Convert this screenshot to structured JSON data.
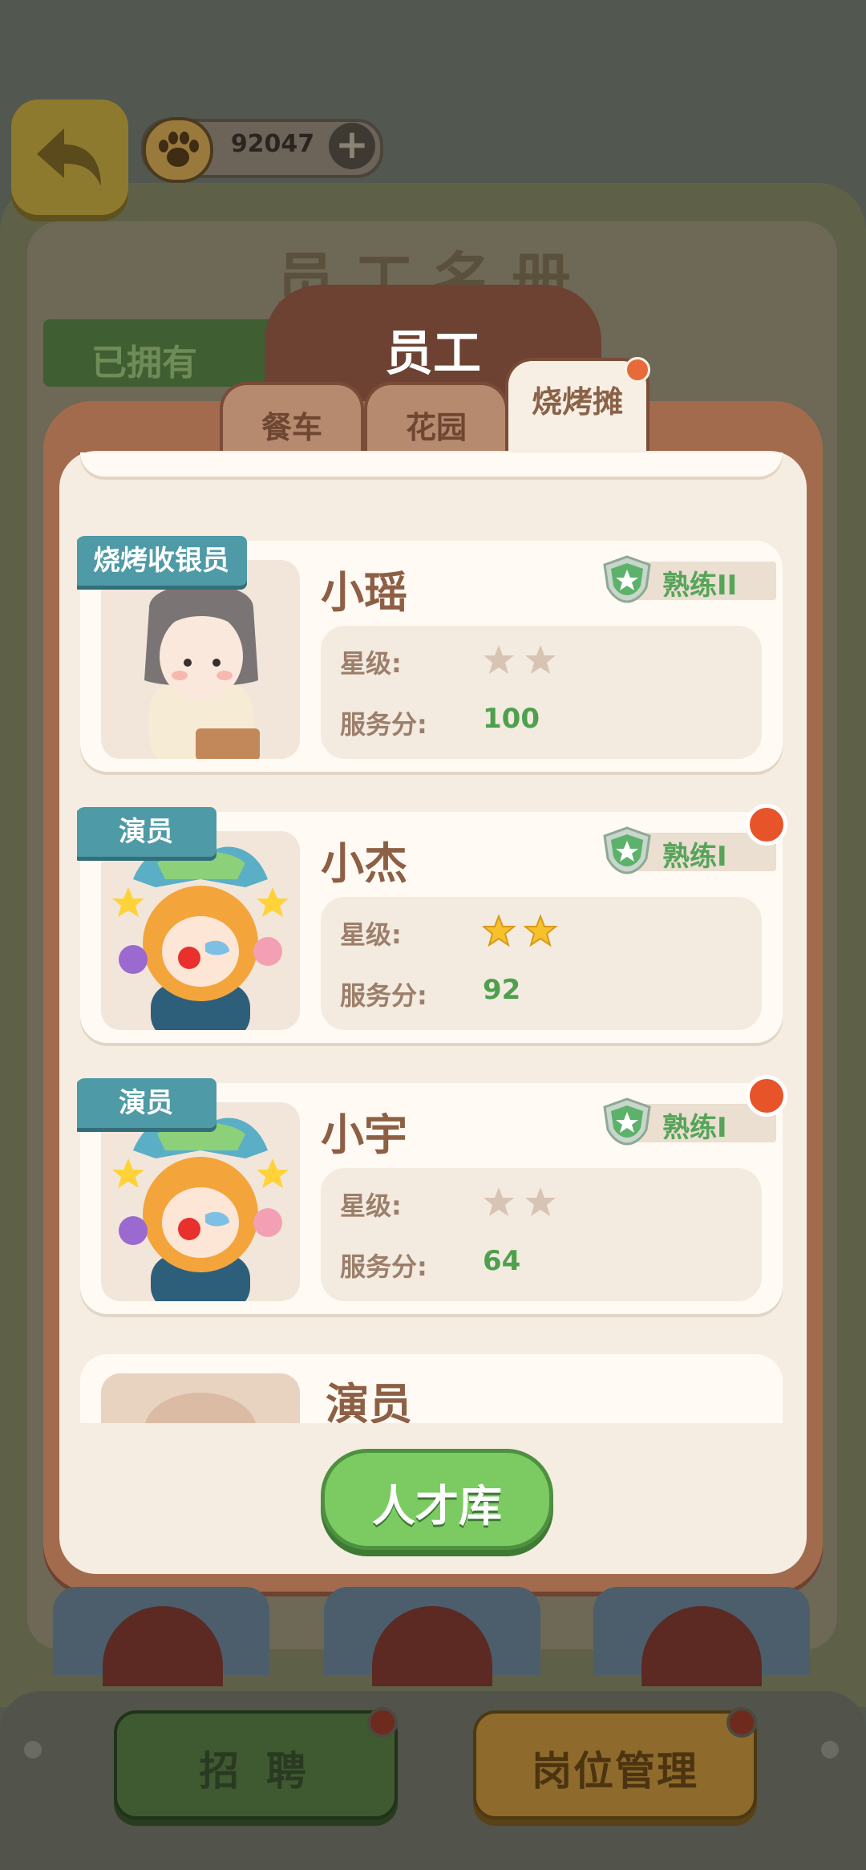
{
  "top_bar": {
    "currency_value": "92047",
    "currency_icon": "paw-coin-icon",
    "back_icon": "back-arrow-icon"
  },
  "book_title": "员工名册",
  "owned_tag": "已拥有",
  "main_tab": "员工",
  "tabs": [
    {
      "label": "餐车"
    },
    {
      "label": "花园"
    },
    {
      "label": "烧烤摊"
    }
  ],
  "stat_labels": {
    "stars": "星级:",
    "score": "服务分:"
  },
  "staff": [
    {
      "role": "烧烤收银员",
      "name": "小瑶",
      "rank": "熟练II",
      "stars_filled": 0,
      "stars_total": 2,
      "score": "100",
      "notify": false
    },
    {
      "role": "演员",
      "name": "小杰",
      "rank": "熟练I",
      "stars_filled": 2,
      "stars_total": 2,
      "score": "92",
      "notify": true
    },
    {
      "role": "演员",
      "name": "小宇",
      "rank": "熟练I",
      "stars_filled": 0,
      "stars_total": 2,
      "score": "64",
      "notify": true
    },
    {
      "role": "",
      "name": "演员",
      "rank": "",
      "stars_filled": 0,
      "stars_total": 0,
      "score": "",
      "notify": false
    }
  ],
  "talent_button": "人才库",
  "bottom": {
    "recruit": "招 聘",
    "management": "岗位管理"
  },
  "colors": {
    "panel": "#a36b4e",
    "accent_green": "#7ccb62",
    "ribbon": "#4e9aa6",
    "notify": "#e8542a"
  }
}
